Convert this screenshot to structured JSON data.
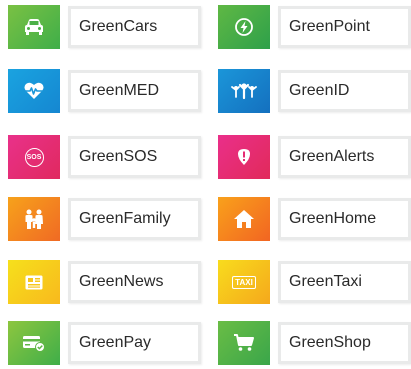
{
  "tiles": [
    {
      "label": "GreenCars",
      "icon": "car-icon",
      "gradient": [
        "#7ac143",
        "#3fae49"
      ]
    },
    {
      "label": "GreenPoint",
      "icon": "lightning-icon",
      "gradient": [
        "#5fb844",
        "#2ea04a"
      ]
    },
    {
      "label": "GreenMED",
      "icon": "heart-pulse-icon",
      "gradient": [
        "#1aa3e0",
        "#1587d1"
      ]
    },
    {
      "label": "GreenID",
      "icon": "people-icon",
      "gradient": [
        "#1b96d9",
        "#1470bf"
      ]
    },
    {
      "label": "GreenSOS",
      "icon": "sos-icon",
      "icon_text": "SOS",
      "gradient": [
        "#e9318a",
        "#e0295f"
      ]
    },
    {
      "label": "GreenAlerts",
      "icon": "alert-shield-icon",
      "gradient": [
        "#ea2f8a",
        "#e12a5a"
      ]
    },
    {
      "label": "GreenFamily",
      "icon": "family-icon",
      "gradient": [
        "#f7a21b",
        "#f06a24"
      ]
    },
    {
      "label": "GreenHome",
      "icon": "home-icon",
      "gradient": [
        "#f9a11b",
        "#f26522"
      ]
    },
    {
      "label": "GreenNews",
      "icon": "newspaper-icon",
      "gradient": [
        "#f6e01c",
        "#f8b91d"
      ]
    },
    {
      "label": "GreenTaxi",
      "icon": "taxi-icon",
      "icon_text": "TAXI",
      "gradient": [
        "#f8dc1d",
        "#f5a81c"
      ]
    },
    {
      "label": "GreenPay",
      "icon": "card-check-icon",
      "gradient": [
        "#8dc63f",
        "#3fae49"
      ]
    },
    {
      "label": "GreenShop",
      "icon": "cart-icon",
      "gradient": [
        "#6abd45",
        "#3aa64a"
      ]
    }
  ]
}
